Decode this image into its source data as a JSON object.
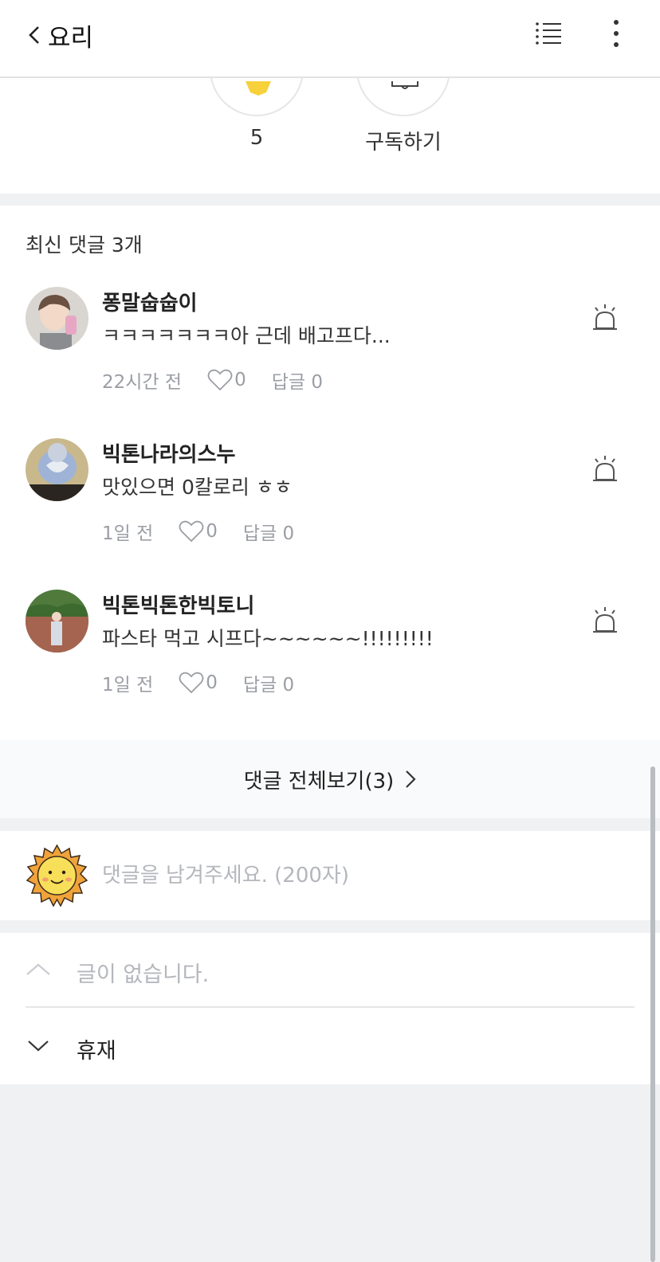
{
  "header": {
    "back_label": "요리",
    "list_icon": "list-icon",
    "more_icon": "more-vertical-icon"
  },
  "top": {
    "rating_value": "5",
    "subscribe_label": "구독하기",
    "colors": {
      "star": "#f7d13c"
    }
  },
  "comments": {
    "title": "최신 댓글 3개",
    "items": [
      {
        "name": "퐁말숩숩이",
        "text": "ㅋㅋㅋㅋㅋㅋㅋ아 근데 배고프다...",
        "time": "22시간 전",
        "likes": "0",
        "reply_label": "답글 0"
      },
      {
        "name": "빅톤나라의스누",
        "text": "맛있으면 0칼로리 ㅎㅎ",
        "time": "1일 전",
        "likes": "0",
        "reply_label": "답글 0"
      },
      {
        "name": "빅톤빅톤한빅토니",
        "text": "파스타 먹고 시프다~~~~~~!!!!!!!!!",
        "time": "1일 전",
        "likes": "0",
        "reply_label": "답글 0"
      }
    ],
    "view_all_label": "댓글 전체보기(3)"
  },
  "write": {
    "placeholder": "댓글을 남겨주세요. (200자)"
  },
  "nav": {
    "prev_label": "글이 없습니다.",
    "next_label": "휴재"
  }
}
